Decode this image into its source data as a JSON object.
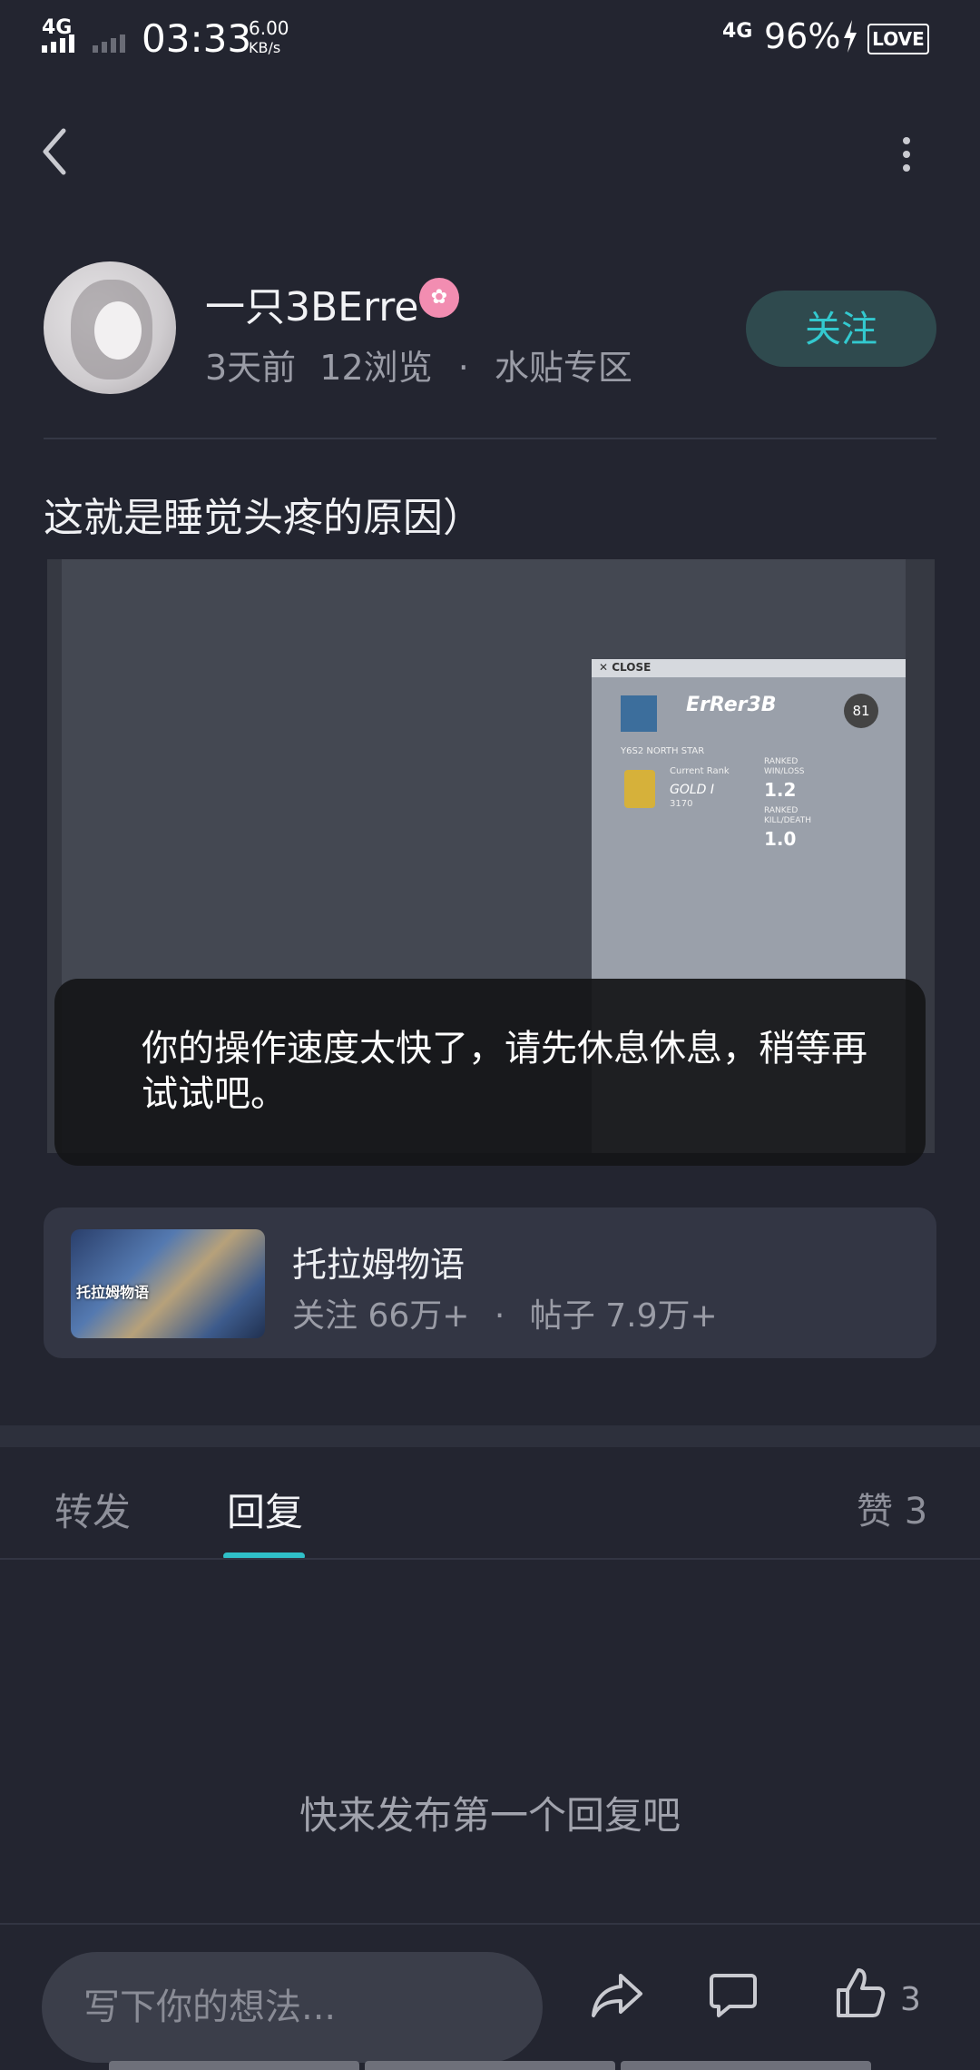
{
  "status_bar": {
    "network_left": "4G",
    "time": "03:33",
    "speed_value": "6.00",
    "speed_unit": "KB/s",
    "network_right": "4G",
    "battery": "96%",
    "badge": "LOVE"
  },
  "author": {
    "name": "一只3BErre",
    "time_ago": "3天前",
    "views": "12浏览",
    "dot": "·",
    "section": "水贴专区",
    "follow_label": "关注"
  },
  "post": {
    "title": "这就是睡觉头疼的原因）",
    "image": {
      "close_label": "CLOSE",
      "player_name": "ErRer3B",
      "level": "81",
      "season": "Y6S2   NORTH STAR",
      "rank_label": "Current Rank",
      "rank_value": "GOLD I",
      "rank_points": "3170",
      "wl_label": "RANKED WIN/LOSS",
      "wl_value": "1.2",
      "kd_label": "RANKED KILL/DEATH",
      "kd_value": "1.0"
    },
    "toast": "你的操作速度太快了，请先休息休息，稍等再试试吧。"
  },
  "community": {
    "thumb_text": "托拉姆物语",
    "name": "托拉姆物语",
    "followers": "关注 66万+",
    "dot": "·",
    "posts": "帖子 7.9万+"
  },
  "tabs": {
    "forward": "转发",
    "reply": "回复",
    "likes": "赞 3"
  },
  "empty_text": "快来发布第一个回复吧",
  "bottom_bar": {
    "input_placeholder": "写下你的想法...",
    "like_count": "3"
  },
  "colors": {
    "background": "#232530",
    "accent": "#2fc0c8",
    "follow_bg": "#2f4a4e"
  }
}
